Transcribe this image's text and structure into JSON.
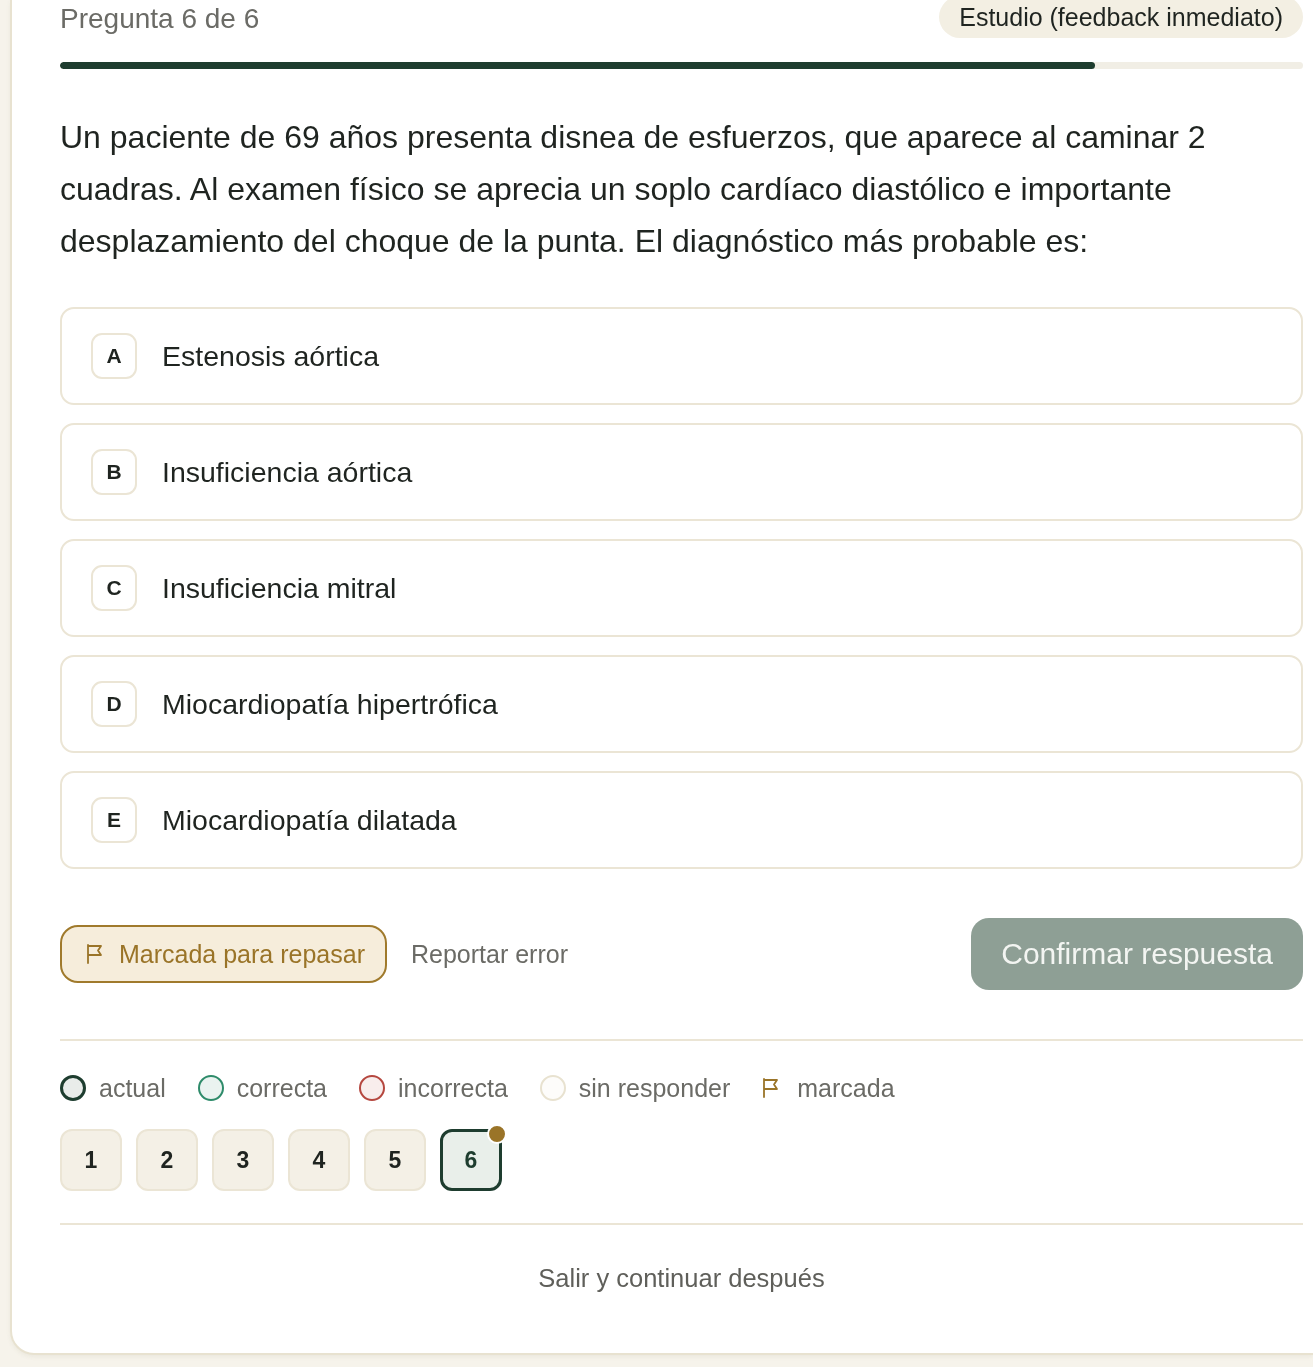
{
  "header": {
    "title": "Pregunta 6 de 6",
    "mode_badge": "Estudio (feedback inmediato)"
  },
  "progress": {
    "level": 0.833
  },
  "question": {
    "text": "Un paciente de 69 años presenta disnea de esfuerzos, que aparece al caminar 2 cuadras. Al examen físico se aprecia un soplo cardíaco diastólico e importante desplazamiento del choque de la punta. El diagnóstico más probable es:"
  },
  "options": [
    {
      "letter": "A",
      "text": "Estenosis aórtica",
      "selected": false
    },
    {
      "letter": "B",
      "text": "Insuficiencia aórtica",
      "selected": false
    },
    {
      "letter": "C",
      "text": "Insuficiencia mitral",
      "selected": false
    },
    {
      "letter": "D",
      "text": "Miocardiopatía hipertrófica",
      "selected": false
    },
    {
      "letter": "E",
      "text": "Miocardiopatía dilatada",
      "selected": false
    }
  ],
  "actions": {
    "flag_button": {
      "label": "Marcada para repasar",
      "on": true
    },
    "report_link": "Reportar error",
    "confirm_button": {
      "label": "Confirmar respuesta",
      "disabled": true
    }
  },
  "legend": [
    {
      "kind": "circle",
      "label": "actual",
      "color": "#1e3d2f"
    },
    {
      "kind": "circle",
      "label": "correcta",
      "color": "#2e8b6a"
    },
    {
      "kind": "circle",
      "label": "incorrecta",
      "color": "#b5473f"
    },
    {
      "kind": "circle",
      "label": "sin responder",
      "color": "#e8e2d0"
    },
    {
      "kind": "flag",
      "label": "marcada",
      "color": "#9a7428"
    }
  ],
  "navigation": [
    {
      "label": "1",
      "selected": false,
      "flagged": false
    },
    {
      "label": "2",
      "selected": false,
      "flagged": false
    },
    {
      "label": "3",
      "selected": false,
      "flagged": false
    },
    {
      "label": "4",
      "selected": false,
      "flagged": false
    },
    {
      "label": "5",
      "selected": false,
      "flagged": false
    },
    {
      "label": "6",
      "selected": true,
      "flagged": true
    }
  ],
  "exit_link": "Salir y continuar después"
}
